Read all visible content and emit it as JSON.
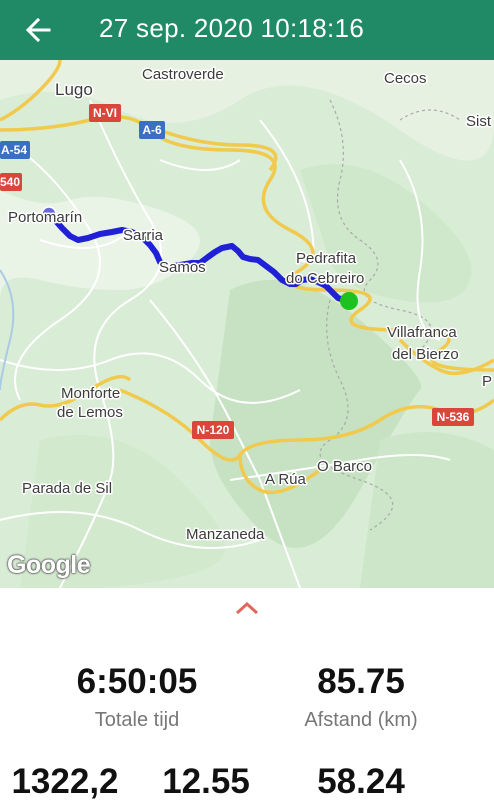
{
  "header": {
    "title": "27 sep. 2020 10:18:16",
    "back_icon": "arrow-back-icon",
    "background": "#1f8a65"
  },
  "map": {
    "places": {
      "lugo": "Lugo",
      "castroverde": "Castroverde",
      "cecos": "Cecos",
      "sist": "Sist",
      "portomarin": "Portomarín",
      "sarria": "Sarria",
      "samos": "Samos",
      "pedrafita_1": "Pedrafita",
      "pedrafita_2": "do Cebreiro",
      "villafranca_1": "Villafranca",
      "villafranca_2": "del Bierzo",
      "monforte_1": "Monforte",
      "monforte_2": "de Lemos",
      "o_barco": "O Barco",
      "a_rua": "A Rúa",
      "parada": "Parada de Sil",
      "manzaneda": "Manzaneda",
      "p": "P"
    },
    "roads": {
      "nvi": "N-VI",
      "a6": "A-6",
      "a54": "A-54",
      "r540": "540",
      "n120": "N-120",
      "n536": "N-536"
    },
    "attribution": "Google",
    "route_color": "#2020d8",
    "end_marker_color": "#1ec21e"
  },
  "panel": {
    "expand_icon": "chevron-up-icon",
    "stats": {
      "total_time": {
        "value": "6:50:05",
        "label": "Totale tijd"
      },
      "distance": {
        "value": "85.75",
        "label": "Afstand (km)"
      },
      "stat3": {
        "value": "1322,2"
      },
      "stat4": {
        "value": "12.55"
      },
      "stat5": {
        "value": "58.24"
      }
    }
  }
}
